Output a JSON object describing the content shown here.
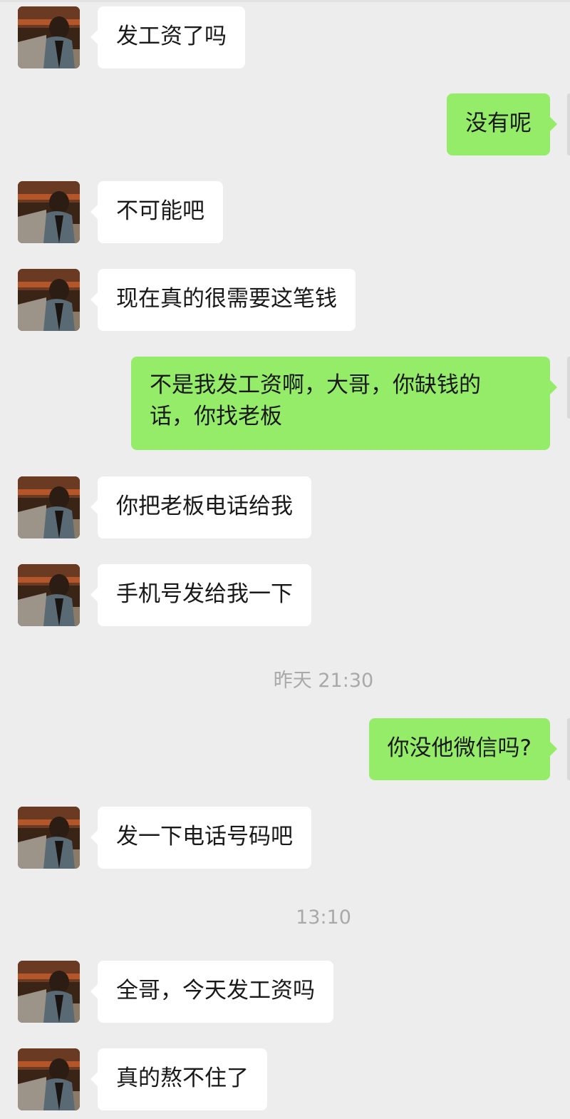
{
  "messages": [
    {
      "side": "in",
      "text": "发工资了吗"
    },
    {
      "side": "out",
      "text": "没有呢"
    },
    {
      "side": "in",
      "text": "不可能吧"
    },
    {
      "side": "in",
      "text": "现在真的很需要这笔钱"
    },
    {
      "side": "out",
      "line1": "不是我发工资啊，大哥，你缺钱的",
      "line2": "话，你找老板"
    },
    {
      "side": "in",
      "text": "你把老板电话给我"
    },
    {
      "side": "in",
      "text": "手机号发给我一下"
    },
    {
      "side": "out",
      "text": "你没他微信吗?"
    },
    {
      "side": "in",
      "text": "发一下电话号码吧"
    },
    {
      "side": "in",
      "text": "全哥，今天发工资吗"
    },
    {
      "side": "in",
      "text": "真的熬不住了"
    }
  ],
  "timestamps": [
    "昨天 21:30",
    "13:10"
  ],
  "colors": {
    "background": "#ededed",
    "incoming_bubble": "#ffffff",
    "outgoing_bubble": "#95ec69",
    "timestamp_text": "#a9a9a9"
  },
  "icons": {
    "contact_avatar": "avatar-photo-icon",
    "self_avatar": "avatar-photo-icon"
  }
}
